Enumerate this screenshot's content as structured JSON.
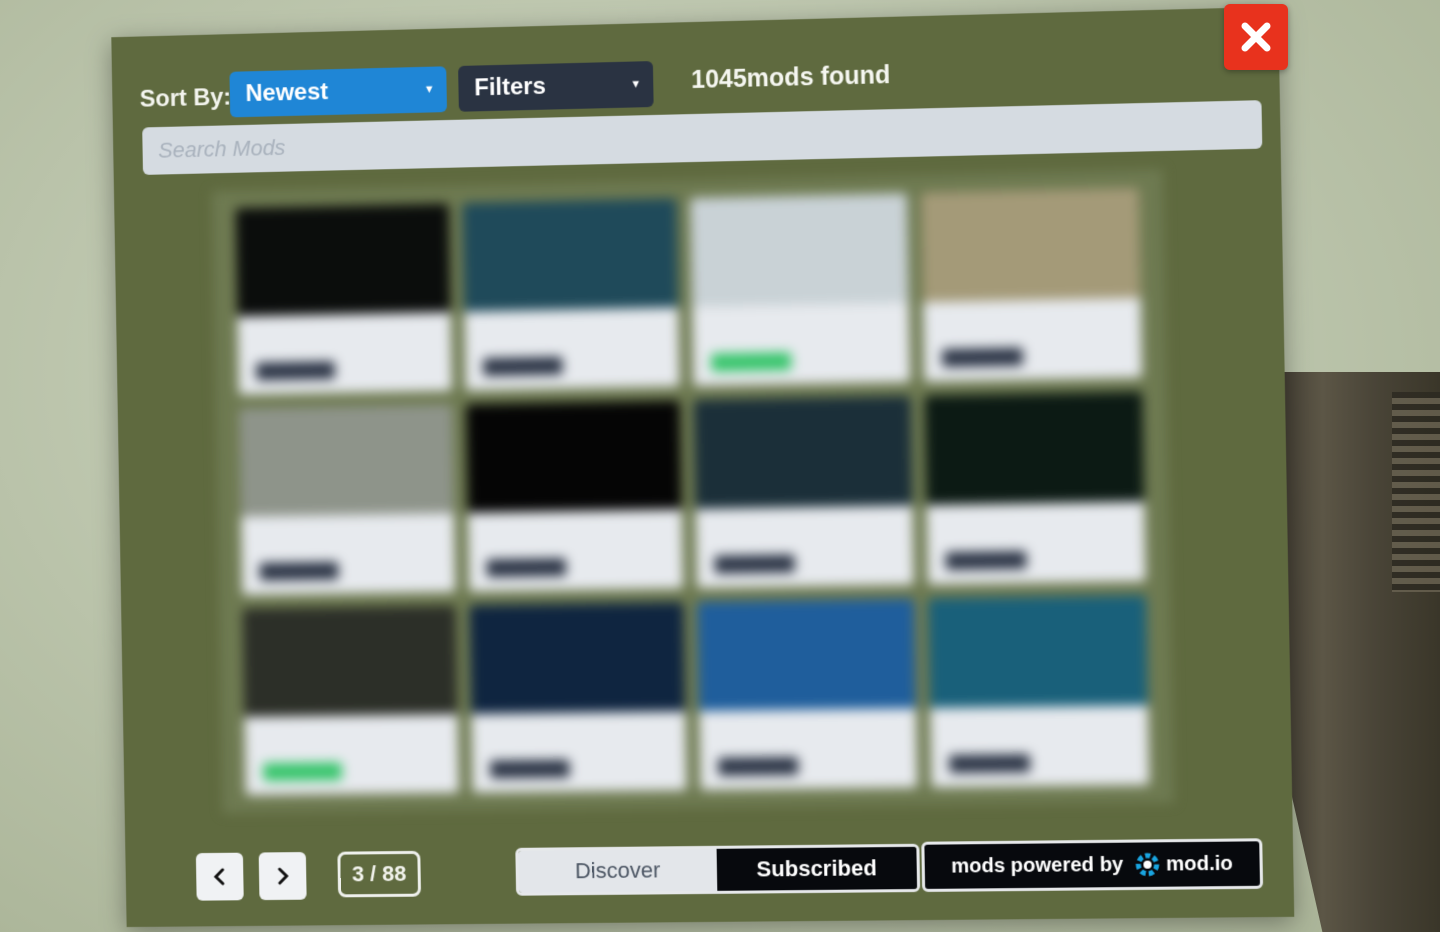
{
  "header": {
    "sort_label": "Sort By:",
    "sort_value": "Newest",
    "filters_label": "Filters",
    "mods_found": "1045mods found"
  },
  "search": {
    "placeholder": "Search Mods",
    "value": ""
  },
  "grid": {
    "cards": [
      {
        "thumb": "#0b0d0c",
        "tag": "dark"
      },
      {
        "thumb": "#1f4a5a",
        "tag": "dark"
      },
      {
        "thumb": "#c9d2d6",
        "tag": "green"
      },
      {
        "thumb": "#a49a78",
        "tag": "dark"
      },
      {
        "thumb": "#8e948a",
        "tag": "dark"
      },
      {
        "thumb": "#050505",
        "tag": "dark"
      },
      {
        "thumb": "#1b2f39",
        "tag": "dark"
      },
      {
        "thumb": "#0c1a14",
        "tag": "dark"
      },
      {
        "thumb": "#2c2f28",
        "tag": "green"
      },
      {
        "thumb": "#0f2540",
        "tag": "dark"
      },
      {
        "thumb": "#1f5e9c",
        "tag": "dark"
      },
      {
        "thumb": "#19607a",
        "tag": "dark"
      }
    ]
  },
  "footer": {
    "page_indicator": "3 / 88",
    "tab_discover": "Discover",
    "tab_subscribed": "Subscribed",
    "powered_by": "mods powered by",
    "brand": "mod.io"
  },
  "colors": {
    "accent": "#1f86d6",
    "close": "#e8321d",
    "panel": "#5f6a3f",
    "active_tab": "#07090d",
    "green_tag": "#36c56b"
  },
  "icons": [
    "close-icon",
    "caret-down-icon",
    "chevron-left-icon",
    "chevron-right-icon",
    "modio-logo-icon"
  ]
}
